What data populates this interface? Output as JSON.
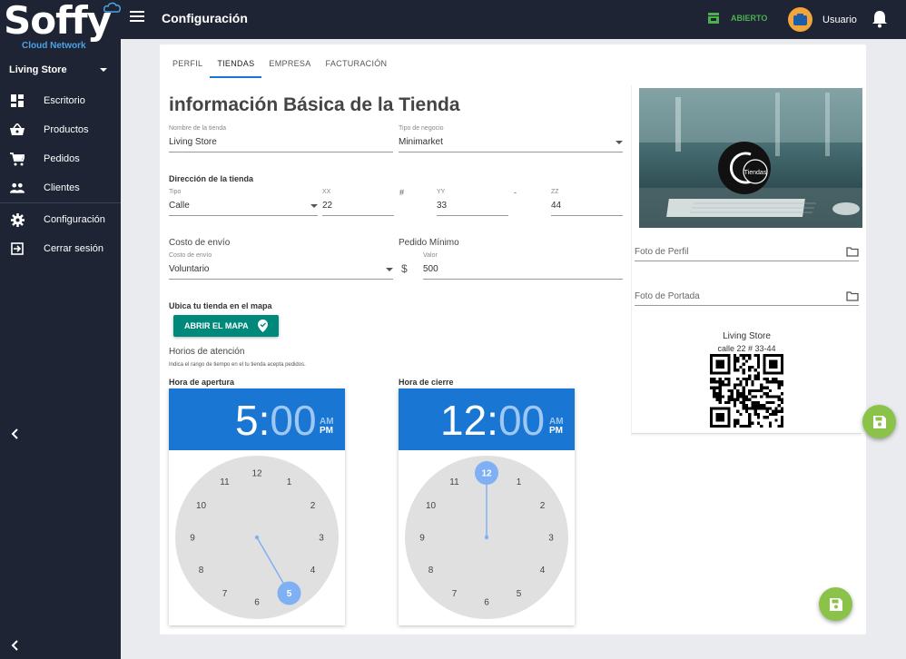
{
  "brand": {
    "name": "Soffy",
    "tagline": "Cloud Network"
  },
  "header": {
    "title": "Configuración",
    "status_label": "ABIERTO",
    "status_color": "#4caf50",
    "user_name": "Usuario"
  },
  "sidebar": {
    "store_selected": "Living Store",
    "items": [
      {
        "label": "Escritorio",
        "icon": "dashboard-icon"
      },
      {
        "label": "Productos",
        "icon": "basket-icon"
      },
      {
        "label": "Pedidos",
        "icon": "cart-icon"
      },
      {
        "label": "Clientes",
        "icon": "people-icon"
      },
      {
        "label": "Configuración",
        "icon": "gear-icon"
      },
      {
        "label": "Cerrar sesión",
        "icon": "logout-icon"
      }
    ]
  },
  "tabs": [
    {
      "label": "PERFIL",
      "active": false
    },
    {
      "label": "TIENDAS",
      "active": true
    },
    {
      "label": "EMPRESA",
      "active": false
    },
    {
      "label": "FACTURACIÓN",
      "active": false
    }
  ],
  "form": {
    "section_title": "información Básica de la Tienda",
    "store_name": {
      "label": "Nombre de la tienda",
      "value": "Living Store"
    },
    "business_type": {
      "label": "Tipo de negocio",
      "value": "Minimarket"
    },
    "address_title": "Dirección de la tienda",
    "address": {
      "type": {
        "label": "Tipo",
        "value": "Calle"
      },
      "xx": {
        "label": "XX",
        "value": "22"
      },
      "hash": "#",
      "yy": {
        "label": "YY",
        "value": "33"
      },
      "dash": "-",
      "zz": {
        "label": "ZZ",
        "value": "44"
      }
    },
    "shipping_title": "Costo de envío",
    "shipping": {
      "label": "Costo de envío",
      "value": "Voluntario"
    },
    "min_order_title": "Pedido Mínimo",
    "currency_symbol": "$",
    "min_order": {
      "label": "Valor",
      "value": "500"
    },
    "map_title": "Ubica tu tienda en el mapa",
    "map_button": "ABRIR EL MAPA",
    "hours_title": "Horios de atención",
    "hours_note": "Indica el rango de tiempo en el tu tienda acepta pedidos.",
    "open_label": "Hora de apertura",
    "close_label": "Hora de cierre"
  },
  "open_time": {
    "hour": "5",
    "minute": "00",
    "am": "AM",
    "pm": "PM",
    "selected_hour": 5
  },
  "close_time": {
    "hour": "12",
    "minute": "00",
    "am": "AM",
    "pm": "PM",
    "selected_hour": 12
  },
  "clock_numbers": [
    "12",
    "1",
    "2",
    "3",
    "4",
    "5",
    "6",
    "7",
    "8",
    "9",
    "10",
    "11"
  ],
  "right_panel": {
    "profile_photo_label": "Foto de Perfil",
    "cover_photo_label": "Foto de Portada",
    "logo_text": "Tiendas",
    "store_name": "Living Store",
    "store_address": "calle 22 # 33-44"
  },
  "colors": {
    "primary": "#1976d2",
    "accent_green": "#8bc34a",
    "map_button": "#00897b",
    "sidebar": "#1e2433",
    "clock_selected": "#7fb0f4"
  }
}
